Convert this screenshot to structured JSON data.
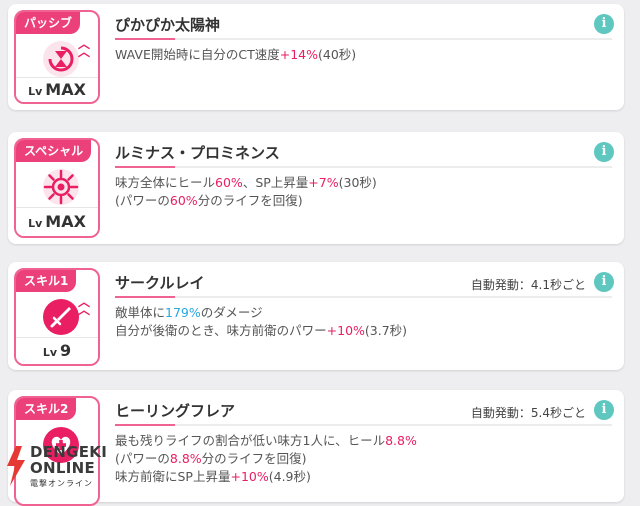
{
  "skills": [
    {
      "tag": "パッシブ",
      "icon": "hourglass-icon",
      "lv_prefix": "Lv",
      "lv_value": "MAX",
      "name": "ぴかぴか太陽神",
      "trigger": "",
      "desc_lines": [
        [
          {
            "t": "WAVE開始時に自分のCT速度"
          },
          {
            "t": "+14%",
            "c": "pk"
          },
          {
            "t": "(40秒)"
          }
        ]
      ]
    },
    {
      "tag": "スペシャル",
      "icon": "sun-icon",
      "lv_prefix": "Lv",
      "lv_value": "MAX",
      "name": "ルミナス・プロミネンス",
      "trigger": "",
      "desc_lines": [
        [
          {
            "t": "味方全体にヒール"
          },
          {
            "t": "60%",
            "c": "pk"
          },
          {
            "t": "、SP上昇量"
          },
          {
            "t": "+7%",
            "c": "pk"
          },
          {
            "t": "(30秒)"
          }
        ],
        [
          {
            "t": "(パワーの"
          },
          {
            "t": "60%",
            "c": "pk"
          },
          {
            "t": "分のライフを回復)"
          }
        ]
      ]
    },
    {
      "tag": "スキル1",
      "icon": "sword-icon",
      "lv_prefix": "Lv",
      "lv_value": "9",
      "name": "サークルレイ",
      "trigger": "自動発動：4.1秒ごと",
      "desc_lines": [
        [
          {
            "t": "敵単体に"
          },
          {
            "t": "179%",
            "c": "bl"
          },
          {
            "t": "のダメージ"
          }
        ],
        [
          {
            "t": "自分が後衛のとき、味方前衛のパワー"
          },
          {
            "t": "+10%",
            "c": "pk"
          },
          {
            "t": "(3.7秒)"
          }
        ]
      ]
    },
    {
      "tag": "スキル2",
      "icon": "heart-plus-icon",
      "lv_prefix": "Lv",
      "lv_value": "",
      "name": "ヒーリングフレア",
      "trigger": "自動発動：5.4秒ごと",
      "desc_lines": [
        [
          {
            "t": "最も残りライフの割合が低い味方1人に、ヒール"
          },
          {
            "t": "8.8%",
            "c": "pk"
          }
        ],
        [
          {
            "t": "(パワーの"
          },
          {
            "t": "8.8%",
            "c": "pk"
          },
          {
            "t": "分のライフを回復)"
          }
        ],
        [
          {
            "t": "味方前衛にSP上昇量"
          },
          {
            "t": "+10%",
            "c": "pk"
          },
          {
            "t": "(4.9秒)"
          }
        ]
      ]
    }
  ],
  "watermark": {
    "text_1": "DENGEKI",
    "text_2": "ONLINE",
    "sub": "電撃オンライン"
  },
  "colors": {
    "accent": "#e91e63",
    "blue_value": "#29a6e0",
    "info": "#5ec7c0"
  }
}
